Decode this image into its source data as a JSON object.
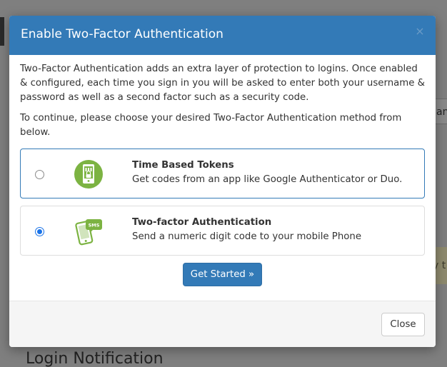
{
  "background": {
    "field_fragment": "an",
    "alert_fragment": "y t",
    "heading": "Login Notification"
  },
  "modal": {
    "title": "Enable Two-Factor Authentication",
    "close_icon": "×",
    "intro_1": "Two-Factor Authentication adds an extra layer of protection to logins. Once enabled & configured, each time you sign in you will be asked to enter both your username & password as well as a second factor such as a security code.",
    "intro_2": "To continue, please choose your desired Two-Factor Authentication method from below.",
    "options": [
      {
        "title": "Time Based Tokens",
        "description": "Get codes from an app like Google Authenticator or Duo.",
        "icon": "token-phone-icon",
        "selected": false
      },
      {
        "title": "Two-factor Authentication",
        "description": "Send a numeric digit code to your mobile Phone",
        "icon": "sms-phone-icon",
        "selected": true
      }
    ],
    "primary_button": "Get Started »",
    "footer_button": "Close"
  },
  "colors": {
    "header": "#337ab7",
    "icon_green": "#7cb342"
  }
}
